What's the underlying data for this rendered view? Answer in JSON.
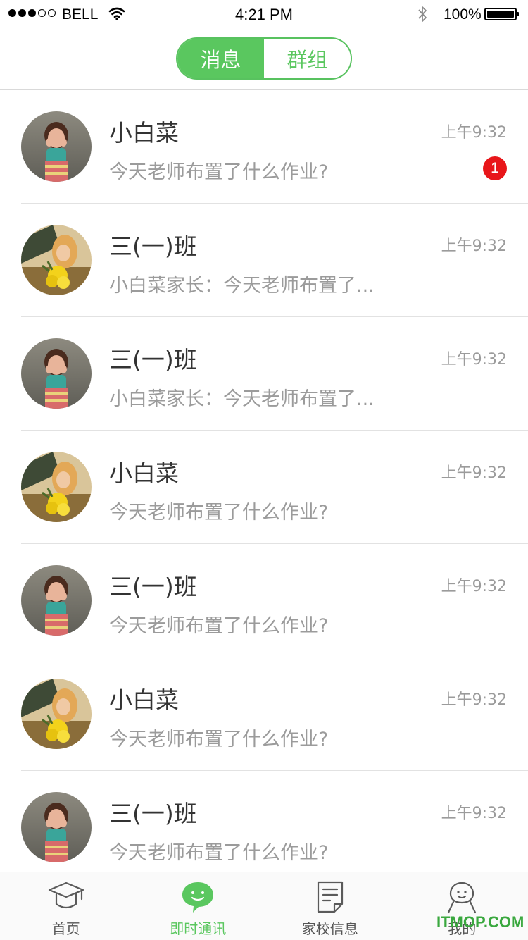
{
  "status_bar": {
    "carrier": "BELL",
    "time": "4:21 PM",
    "battery": "100%",
    "signal_filled": 3,
    "signal_total": 5
  },
  "segmented": {
    "messages_label": "消息",
    "groups_label": "群组",
    "active": "messages"
  },
  "conversations": [
    {
      "name": "小白菜",
      "time": "上午9:32",
      "preview": "今天老师布置了什么作业?",
      "avatar": "girl-portrait",
      "unread": "1"
    },
    {
      "name": "三(一)班",
      "time": "上午9:32",
      "preview": "小白菜家长：今天老师布置了...",
      "avatar": "girl-flowers",
      "unread": ""
    },
    {
      "name": "三(一)班",
      "time": "上午9:32",
      "preview": "小白菜家长：今天老师布置了...",
      "avatar": "girl-portrait",
      "unread": ""
    },
    {
      "name": "小白菜",
      "time": "上午9:32",
      "preview": "今天老师布置了什么作业?",
      "avatar": "girl-flowers",
      "unread": ""
    },
    {
      "name": "三(一)班",
      "time": "上午9:32",
      "preview": "今天老师布置了什么作业?",
      "avatar": "girl-portrait",
      "unread": ""
    },
    {
      "name": "小白菜",
      "time": "上午9:32",
      "preview": "今天老师布置了什么作业?",
      "avatar": "girl-flowers",
      "unread": ""
    },
    {
      "name": "三(一)班",
      "time": "上午9:32",
      "preview": "今天老师布置了什么作业?",
      "avatar": "girl-portrait",
      "unread": ""
    }
  ],
  "tabbar": [
    {
      "label": "首页",
      "icon": "graduation-cap-icon",
      "active": false
    },
    {
      "label": "即时通讯",
      "icon": "chat-bubble-icon",
      "active": true
    },
    {
      "label": "家校信息",
      "icon": "document-icon",
      "active": false
    },
    {
      "label": "我的",
      "icon": "person-icon",
      "active": false
    }
  ],
  "watermark": "ITMOP.COM",
  "colors": {
    "accent": "#5ac75f",
    "badge": "#e8161a",
    "secondary_text": "#9b9b9b"
  }
}
